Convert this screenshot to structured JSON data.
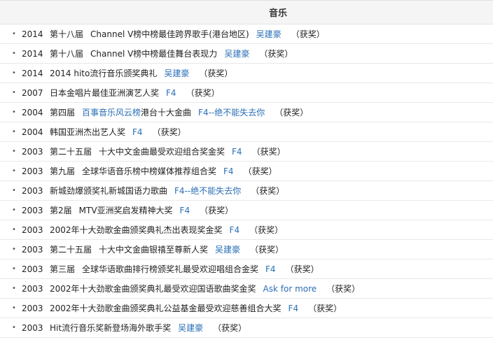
{
  "header": {
    "title": "音乐"
  },
  "rows": [
    {
      "year": "2014",
      "pre": "第十八届",
      "pre_link": "",
      "award": "Channel V榜中榜最佳跨界歌手(港台地区)",
      "nominee": "吴建豪",
      "status": "（获奖）"
    },
    {
      "year": "2014",
      "pre": "第十八届",
      "pre_link": "",
      "award": "Channel V榜中榜最佳舞台表现力",
      "nominee": "吴建豪",
      "status": "（获奖）"
    },
    {
      "year": "2014",
      "pre": "",
      "pre_link": "",
      "award": "2014 hito流行音乐颁奖典礼",
      "nominee": "吴建豪",
      "status": "（获奖）"
    },
    {
      "year": "2007",
      "pre": "",
      "pre_link": "",
      "award": "日本金唱片最佳亚洲演艺人奖",
      "nominee": "F4",
      "status": "（获奖）"
    },
    {
      "year": "2004",
      "pre": "第四届",
      "pre_link": "百事音乐风云榜",
      "award": "港台十大金曲",
      "nominee": "F4--绝不能失去你",
      "status": "（获奖）"
    },
    {
      "year": "2004",
      "pre": "",
      "pre_link": "",
      "award": "韩国亚洲杰出艺人奖",
      "nominee": "F4",
      "status": "（获奖）"
    },
    {
      "year": "2003",
      "pre": "第二十五届",
      "pre_link": "",
      "award": "十大中文金曲最受欢迎组合奖金奖",
      "nominee": "F4",
      "status": "（获奖）"
    },
    {
      "year": "2003",
      "pre": "第九届",
      "pre_link": "",
      "award": "全球华语音乐榜中榜媒体推荐组合奖",
      "nominee": "F4",
      "status": "（获奖）"
    },
    {
      "year": "2003",
      "pre": "",
      "pre_link": "",
      "award": "新城劲爆颁奖礼新城国语力歌曲",
      "nominee": "F4--绝不能失去你",
      "status": "（获奖）"
    },
    {
      "year": "2003",
      "pre": "第2届",
      "pre_link": "",
      "award": "MTV亚洲奖启发精神大奖",
      "nominee": "F4",
      "status": "（获奖）"
    },
    {
      "year": "2003",
      "pre": "",
      "pre_link": "",
      "award": "2002年十大劲歌金曲颁奖典礼杰出表现奖金奖",
      "nominee": "F4",
      "status": "（获奖）"
    },
    {
      "year": "2003",
      "pre": "第二十五届",
      "pre_link": "",
      "award": "十大中文金曲银禧至尊新人奖",
      "nominee": "吴建豪",
      "status": "（获奖）"
    },
    {
      "year": "2003",
      "pre": "第三届",
      "pre_link": "",
      "award": "全球华语歌曲排行榜颁奖礼最受欢迎唱组合金奖",
      "nominee": "F4",
      "status": "（获奖）"
    },
    {
      "year": "2003",
      "pre": "",
      "pre_link": "",
      "award": "2002年十大劲歌金曲颁奖典礼最受欢迎国语歌曲奖金奖",
      "nominee": "Ask for more",
      "status": "（获奖）"
    },
    {
      "year": "2003",
      "pre": "",
      "pre_link": "",
      "award": "2002年十大劲歌金曲颁奖典礼公益基金最受欢迎慈善组合大奖",
      "nominee": "F4",
      "status": "（获奖）"
    },
    {
      "year": "2003",
      "pre": "",
      "pre_link": "",
      "award": "Hit流行音乐奖新登场海外歌手奖",
      "nominee": "吴建豪",
      "status": "（获奖）"
    }
  ],
  "colors": {
    "link": "#2b6fb6",
    "header_bg": "#f5f5f5"
  }
}
